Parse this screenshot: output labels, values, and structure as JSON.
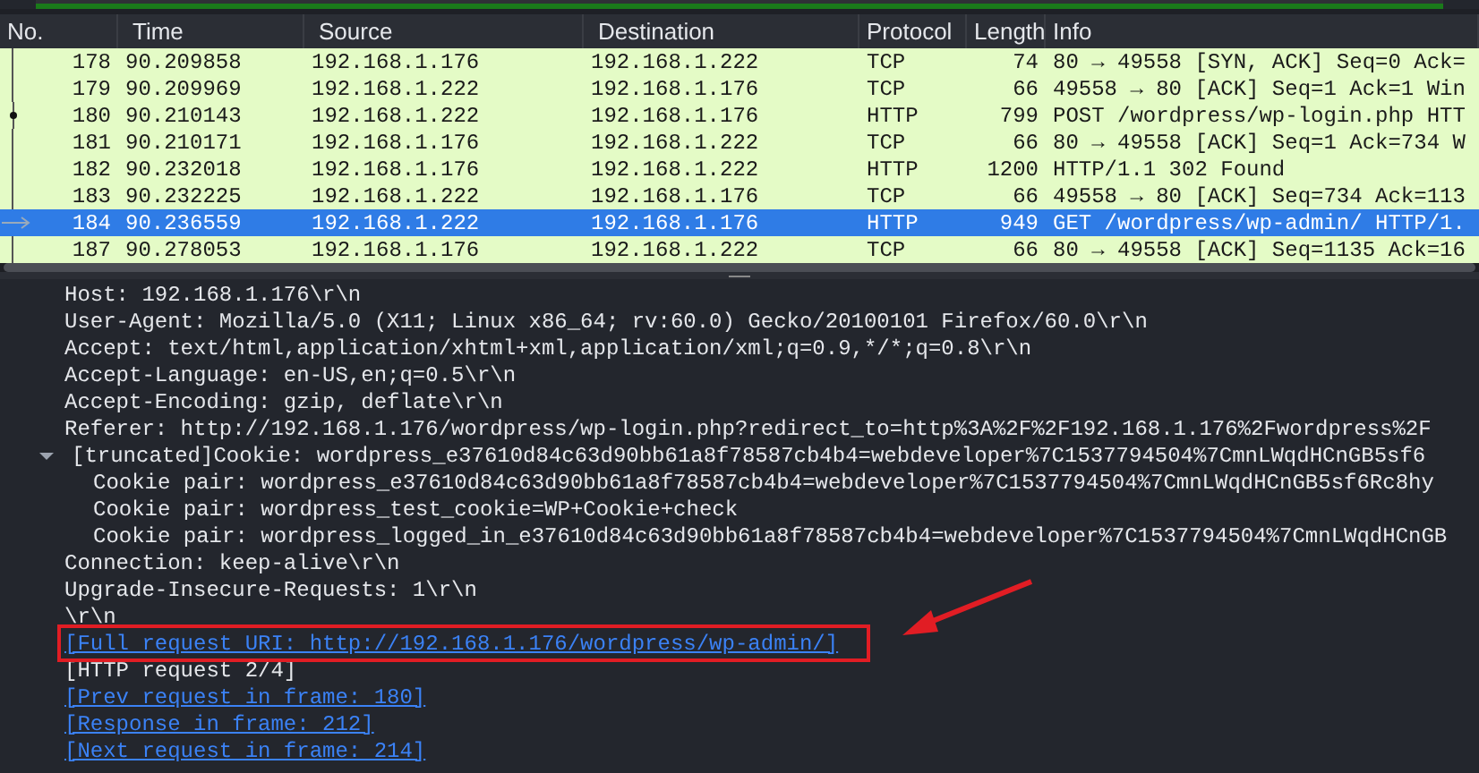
{
  "packet_list": {
    "columns": [
      "No.",
      "Time",
      "Source",
      "Destination",
      "Protocol",
      "Length",
      "Info"
    ],
    "rows": [
      {
        "no": "178",
        "time": "90.209858",
        "source": "192.168.1.176",
        "destination": "192.168.1.222",
        "protocol": "TCP",
        "length": "74",
        "info": "80 → 49558 [SYN, ACK] Seq=0 Ack=",
        "selected": false,
        "marker": {
          "kind": "line"
        }
      },
      {
        "no": "179",
        "time": "90.209969",
        "source": "192.168.1.222",
        "destination": "192.168.1.176",
        "protocol": "TCP",
        "length": "66",
        "info": "49558 → 80 [ACK] Seq=1 Ack=1 Win",
        "selected": false,
        "marker": {
          "kind": "line"
        }
      },
      {
        "no": "180",
        "time": "90.210143",
        "source": "192.168.1.222",
        "destination": "192.168.1.176",
        "protocol": "HTTP",
        "length": "799",
        "info": "POST /wordpress/wp-login.php HTT",
        "selected": false,
        "marker": {
          "kind": "dot"
        }
      },
      {
        "no": "181",
        "time": "90.210171",
        "source": "192.168.1.176",
        "destination": "192.168.1.222",
        "protocol": "TCP",
        "length": "66",
        "info": "80 → 49558 [ACK] Seq=1 Ack=734 W",
        "selected": false,
        "marker": {
          "kind": "line"
        }
      },
      {
        "no": "182",
        "time": "90.232018",
        "source": "192.168.1.176",
        "destination": "192.168.1.222",
        "protocol": "HTTP",
        "length": "1200",
        "info": "HTTP/1.1 302 Found",
        "selected": false,
        "marker": {
          "kind": "line"
        }
      },
      {
        "no": "183",
        "time": "90.232225",
        "source": "192.168.1.222",
        "destination": "192.168.1.176",
        "protocol": "TCP",
        "length": "66",
        "info": "49558 → 80 [ACK] Seq=734 Ack=113",
        "selected": false,
        "marker": {
          "kind": "line"
        }
      },
      {
        "no": "184",
        "time": "90.236559",
        "source": "192.168.1.222",
        "destination": "192.168.1.176",
        "protocol": "HTTP",
        "length": "949",
        "info": "GET /wordpress/wp-admin/ HTTP/1.",
        "selected": true,
        "marker": {
          "kind": "arrow"
        }
      },
      {
        "no": "187",
        "time": "90.278053",
        "source": "192.168.1.176",
        "destination": "192.168.1.222",
        "protocol": "TCP",
        "length": "66",
        "info": "80 → 49558 [ACK] Seq=1135 Ack=16",
        "selected": false,
        "marker": {
          "kind": "line"
        }
      }
    ]
  },
  "details": [
    {
      "kind": "text",
      "text": "Host: 192.168.1.176\\r\\n"
    },
    {
      "kind": "text",
      "text": "User-Agent: Mozilla/5.0 (X11; Linux x86_64; rv:60.0) Gecko/20100101 Firefox/60.0\\r\\n"
    },
    {
      "kind": "text",
      "text": "Accept: text/html,application/xhtml+xml,application/xml;q=0.9,*/*;q=0.8\\r\\n"
    },
    {
      "kind": "text",
      "text": "Accept-Language: en-US,en;q=0.5\\r\\n"
    },
    {
      "kind": "text",
      "text": "Accept-Encoding: gzip, deflate\\r\\n"
    },
    {
      "kind": "text",
      "text": "Referer: http://192.168.1.176/wordpress/wp-login.php?redirect_to=http%3A%2F%2F192.168.1.176%2Fwordpress%2F"
    },
    {
      "kind": "text",
      "text": "[truncated]Cookie: wordpress_e37610d84c63d90bb61a8f78587cb4b4=webdeveloper%7C1537794504%7CmnLWqdHCnGB5sf6",
      "expanded": true,
      "children": [
        {
          "kind": "text",
          "text": "Cookie pair: wordpress_e37610d84c63d90bb61a8f78587cb4b4=webdeveloper%7C1537794504%7CmnLWqdHCnGB5sf6Rc8hy"
        },
        {
          "kind": "text",
          "text": "Cookie pair: wordpress_test_cookie=WP+Cookie+check"
        },
        {
          "kind": "text",
          "text": "Cookie pair: wordpress_logged_in_e37610d84c63d90bb61a8f78587cb4b4=webdeveloper%7C1537794504%7CmnLWqdHCnGB"
        }
      ]
    },
    {
      "kind": "text",
      "text": "Connection: keep-alive\\r\\n"
    },
    {
      "kind": "text",
      "text": "Upgrade-Insecure-Requests: 1\\r\\n"
    },
    {
      "kind": "text",
      "text": "\\r\\n"
    },
    {
      "kind": "link",
      "text": "[Full request URI: http://192.168.1.176/wordpress/wp-admin/]",
      "highlighted": true
    },
    {
      "kind": "text",
      "text": "[HTTP request 2/4]"
    },
    {
      "kind": "link",
      "text": "[Prev request in frame: 180]",
      "highlighted": false
    },
    {
      "kind": "link",
      "text": "[Response in frame: 212]",
      "highlighted": false
    },
    {
      "kind": "link",
      "text": "[Next request in frame: 214]",
      "highlighted": false
    }
  ]
}
